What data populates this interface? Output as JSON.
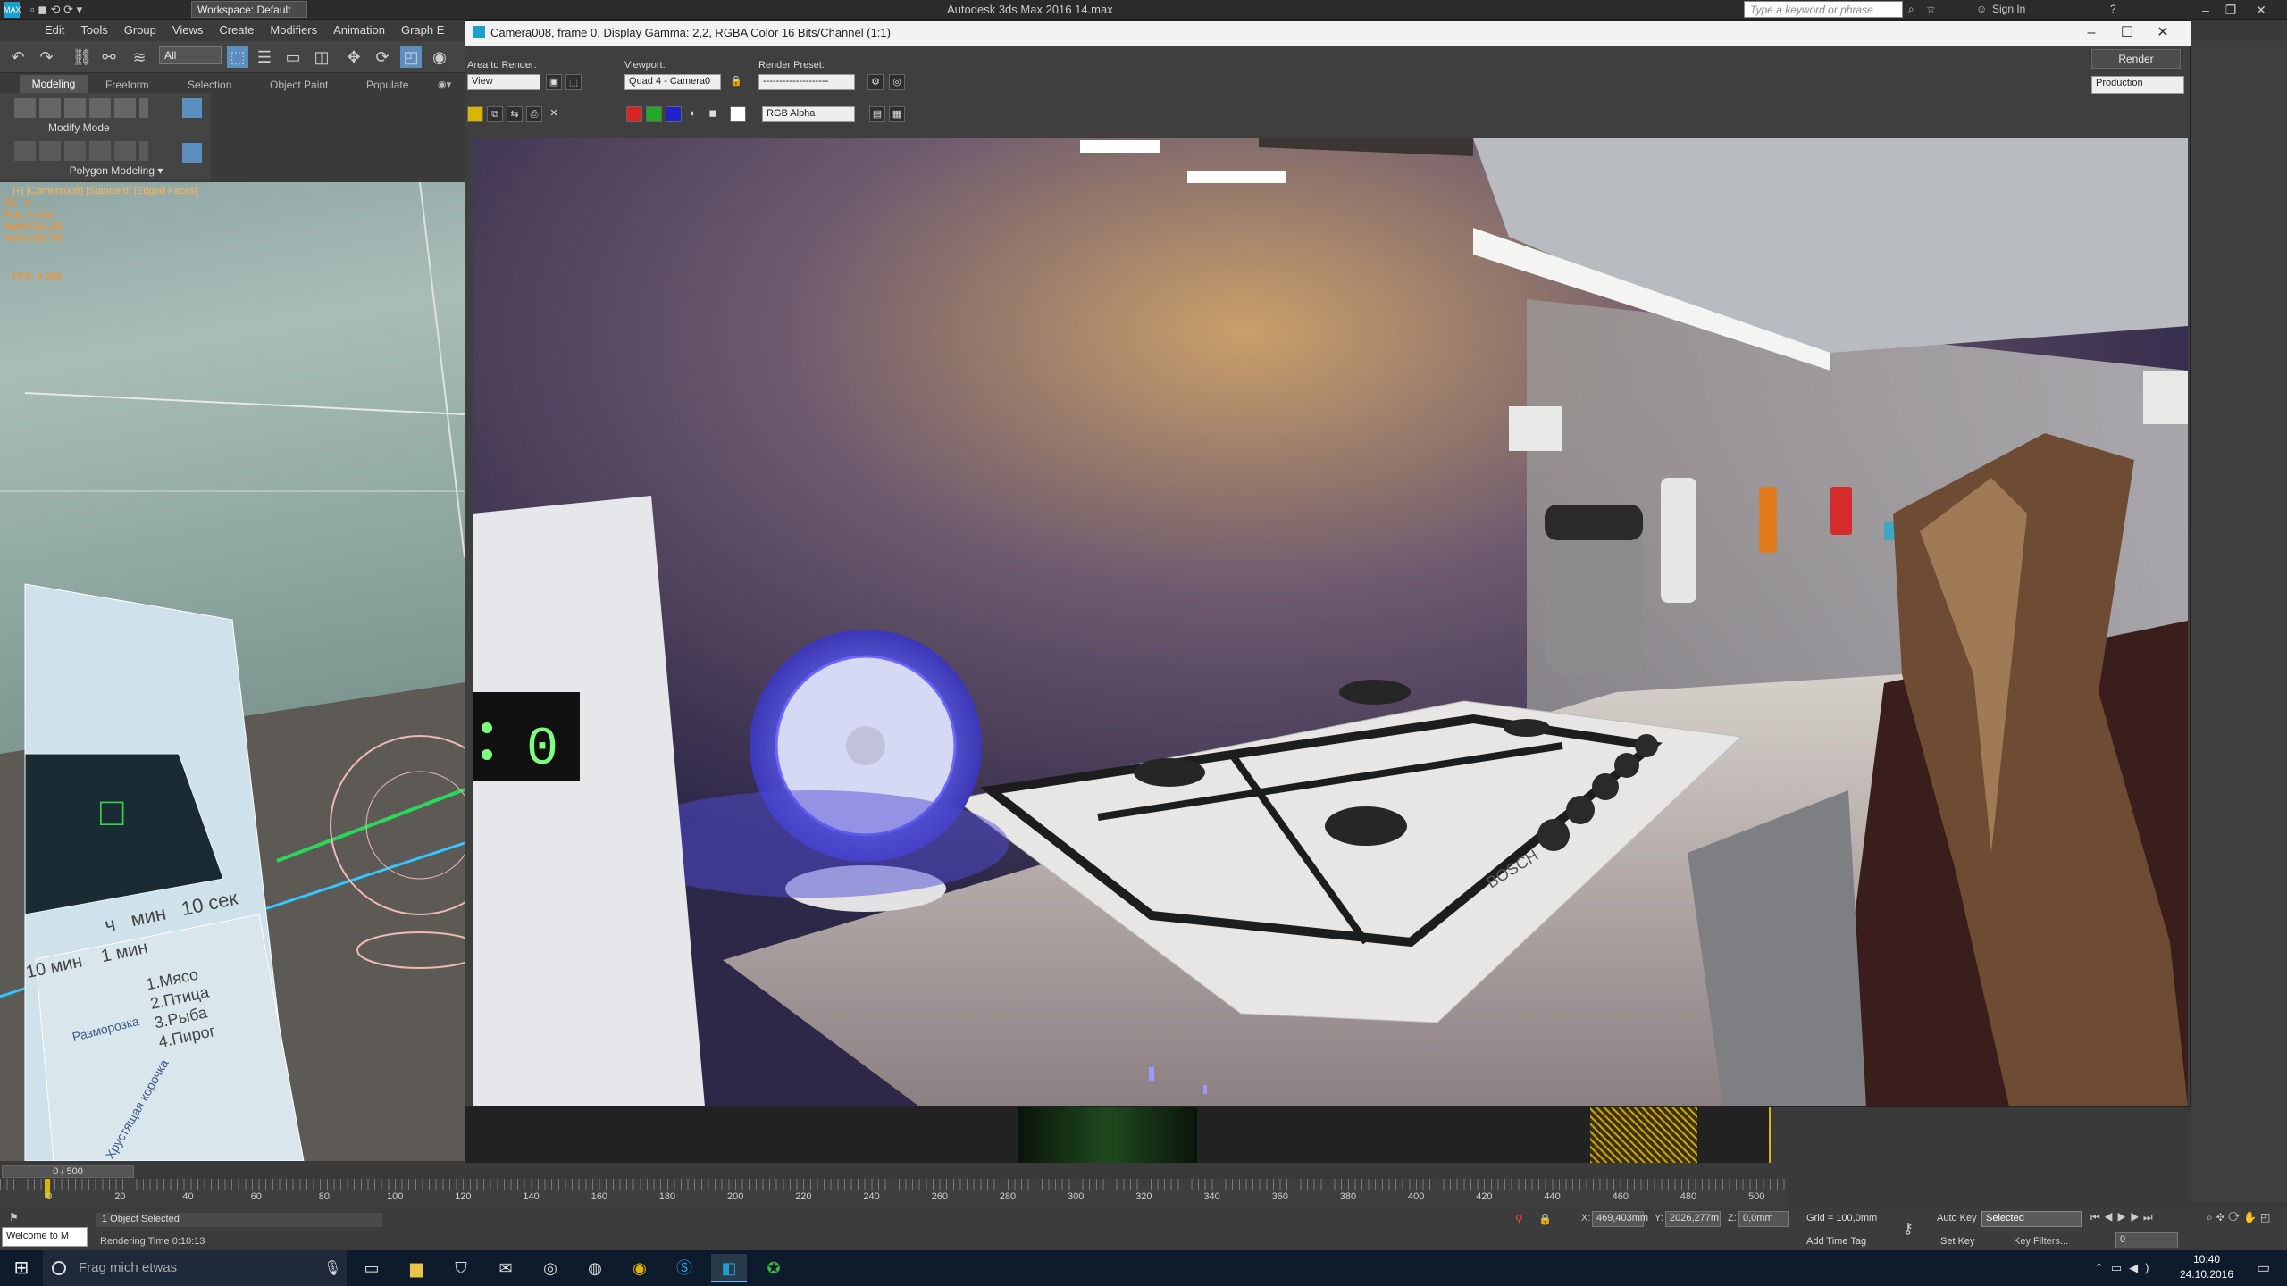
{
  "main_window": {
    "app_title": "Autodesk 3ds Max 2016      14.max",
    "workspace": "Workspace: Default",
    "search_placeholder": "Type a keyword or phrase",
    "sign_in": "Sign In"
  },
  "menu": [
    "Edit",
    "Tools",
    "Group",
    "Views",
    "Create",
    "Modifiers",
    "Animation",
    "Graph E"
  ],
  "toolbar": {
    "selection_filter": "All"
  },
  "ribbon": {
    "tabs": [
      "Modeling",
      "Freeform",
      "Selection",
      "Object Paint",
      "Populate"
    ],
    "modify_mode": "Modify Mode",
    "panel": "Polygon Modeling"
  },
  "viewport": {
    "label": "[+] [Camera008] [Standard] [Edged Faces]",
    "stats": "Tot   V   -\nPoly  5.184\nVerts 634.188\nVerts 618.746",
    "fps": "FPS:  9.060"
  },
  "render_window": {
    "title": "Camera008, frame 0, Display Gamma: 2,2, RGBA Color 16 Bits/Channel (1:1)",
    "area_to_render_label": "Area to Render:",
    "area_to_render": "View",
    "viewport_label": "Viewport:",
    "viewport_value": "Quad 4 - Camera0",
    "render_preset_label": "Render Preset:",
    "render_preset_value": "--------------------",
    "render_button": "Render",
    "production": "Production",
    "channel": "RGB Alpha",
    "microwave_digit": "0",
    "hob_brand": "BOSCH"
  },
  "viewport_scene": {
    "microwave_labels": [
      "ч",
      "мин",
      "10 сек",
      "1 мин",
      "10 мин"
    ],
    "microwave_menu": "1.Мясо\n2.Птица\n3.Рыба\n4.Пирог",
    "defrost": "Разморозка",
    "crispy": "Хрустящая корочка"
  },
  "timeline": {
    "slider": "0 / 500",
    "ticks": [
      "0",
      "20",
      "40",
      "60",
      "80",
      "100",
      "120",
      "140",
      "160",
      "180",
      "200",
      "220",
      "240",
      "260",
      "280",
      "300",
      "320",
      "340",
      "360",
      "380",
      "400",
      "420",
      "440",
      "460",
      "480",
      "500"
    ]
  },
  "status": {
    "selected": "1 Object Selected",
    "render_time": "Rendering Time  0:10:13",
    "welcome": "Welcome to M",
    "x_label": "X:",
    "x_value": "469,403mm",
    "y_label": "Y:",
    "y_value": "2026,277m",
    "z_label": "Z:",
    "z_value": "0,0mm",
    "grid": "Grid = 100,0mm",
    "add_time_tag": "Add Time Tag",
    "auto_key": "Auto Key",
    "set_key": "Set Key",
    "key_mode": "Selected",
    "key_filters": "Key Filters...",
    "frame": "0"
  },
  "taskbar": {
    "search_placeholder": "Frag mich etwas",
    "time": "10:40",
    "date": "24.10.2016"
  },
  "colors": {
    "accent_blue": "#1b9fd0",
    "viewport_text": "#ff8c1a"
  }
}
